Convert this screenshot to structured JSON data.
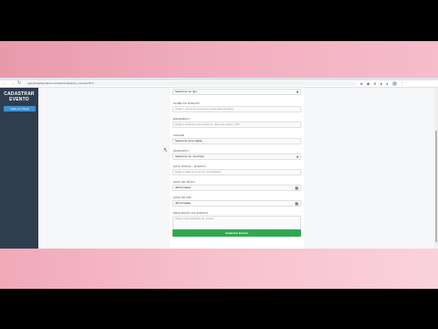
{
  "browser": {
    "url": "ppeventsattendance.com/adm/cadastrar_eventos.html",
    "nav": {
      "back": "←",
      "forward": "→",
      "reload": "↻"
    },
    "extension_icons": [
      "★",
      "◉",
      "⬇",
      "●",
      "●",
      "⋮"
    ]
  },
  "sidebar": {
    "title": "CADASTRAR EVENTO",
    "button_label": "Voltar ao Painel"
  },
  "form": {
    "top_select": {
      "value": "Selecione um tipo"
    },
    "fields": [
      {
        "label": "NOME DO EVENTO",
        "placeholder": "Digite o nome do evento ex: Feira Agropecuária"
      },
      {
        "label": "ENDEREÇO",
        "placeholder": "Digite o endereço do evento ex: Rua das Flores, 123"
      },
      {
        "label": "CIDADE",
        "value": "Selecione uma cidade",
        "type": "select"
      },
      {
        "label": "MUNICÍPIO",
        "value": "Selecione um município",
        "type": "select"
      },
      {
        "label": "DATA INICIAL - EVENTO",
        "placeholder": "Digite a data de início ex: 01/01/2025"
      },
      {
        "label": "DATA DE INÍCIO",
        "value": "dd/mm/aaaa",
        "type": "date"
      },
      {
        "label": "DATA DE FIM",
        "value": "dd/mm/aaaa",
        "type": "date"
      }
    ],
    "textarea": {
      "label": "DESCRIÇÃO DO EVENTO",
      "placeholder": "Digite uma descrição do evento"
    },
    "submit_label": "Cadastrar Evento"
  },
  "icons": {
    "select_arrow": "▾",
    "calendar": "▦",
    "cursor": "↖"
  }
}
